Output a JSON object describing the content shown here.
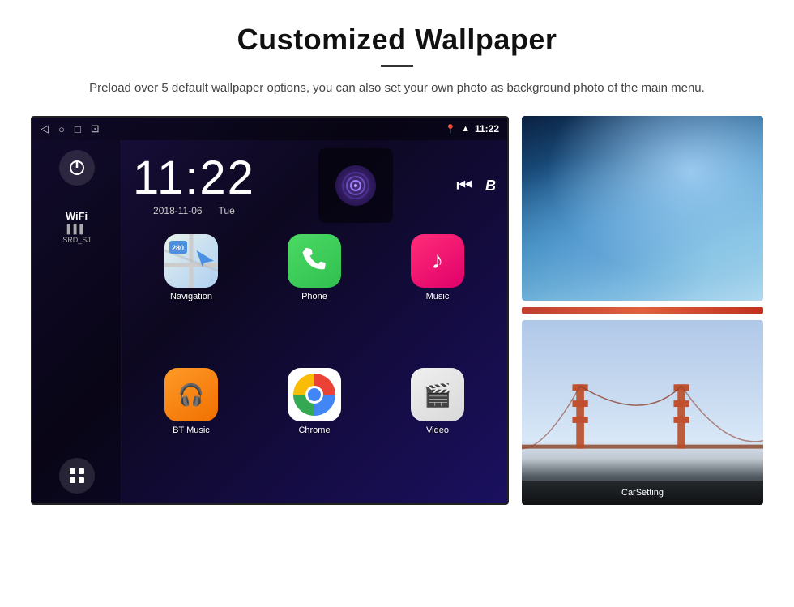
{
  "header": {
    "title": "Customized Wallpaper",
    "subtitle": "Preload over 5 default wallpaper options, you can also set your own photo as background photo of the main menu."
  },
  "screen": {
    "status_bar": {
      "time": "11:22",
      "nav_back": "◁",
      "nav_home": "○",
      "nav_recent": "□",
      "nav_screenshot": "⊡"
    },
    "clock": {
      "time": "11:22",
      "date": "2018-11-06",
      "day": "Tue"
    },
    "wifi": {
      "label": "WiFi",
      "ssid": "SRD_SJ"
    },
    "apps": [
      {
        "label": "Navigation",
        "type": "nav"
      },
      {
        "label": "Phone",
        "type": "phone"
      },
      {
        "label": "Music",
        "type": "music"
      },
      {
        "label": "BT Music",
        "type": "bt"
      },
      {
        "label": "Chrome",
        "type": "chrome"
      },
      {
        "label": "Video",
        "type": "video"
      }
    ],
    "carsetting": {
      "label": "CarSetting"
    }
  },
  "wallpapers": {
    "top_label": "Ice/Blue wallpaper",
    "bottom_label": "Golden Gate Bridge wallpaper"
  }
}
